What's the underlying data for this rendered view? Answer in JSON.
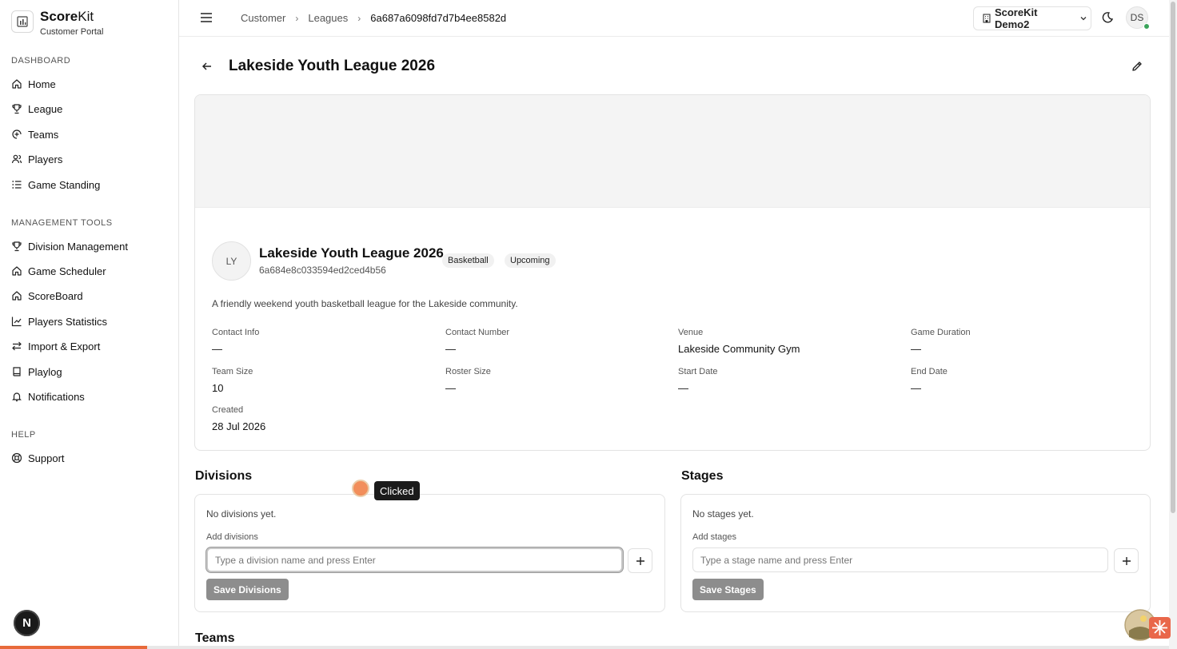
{
  "brand": {
    "name_bold": "Score",
    "name_light": "Kit",
    "subtitle": "Customer Portal"
  },
  "sidebar": {
    "sections": [
      {
        "label": "DASHBOARD"
      },
      {
        "label": "MANAGEMENT TOOLS"
      },
      {
        "label": "HELP"
      }
    ],
    "items": [
      {
        "label": "Home",
        "icon": "home-icon"
      },
      {
        "label": "League",
        "icon": "trophy-icon"
      },
      {
        "label": "Teams",
        "icon": "teams-icon"
      },
      {
        "label": "Players",
        "icon": "players-icon"
      },
      {
        "label": "Game Standing",
        "icon": "list-icon"
      },
      {
        "label": "Division Management",
        "icon": "trophy-icon"
      },
      {
        "label": "Game Scheduler",
        "icon": "home-icon"
      },
      {
        "label": "ScoreBoard",
        "icon": "home-icon"
      },
      {
        "label": "Players Statistics",
        "icon": "chart-icon"
      },
      {
        "label": "Import & Export",
        "icon": "swap-icon"
      },
      {
        "label": "Playlog",
        "icon": "book-icon"
      },
      {
        "label": "Notifications",
        "icon": "bell-icon"
      },
      {
        "label": "Support",
        "icon": "lifebuoy-icon"
      }
    ],
    "bottom_badge": "N"
  },
  "header": {
    "breadcrumbs": [
      "Customer",
      "Leagues",
      "6a687a6098fd7d7b4ee8582d"
    ],
    "org_name": "ScoreKit Demo2",
    "avatar_initials": "DS"
  },
  "page": {
    "title": "Lakeside Youth League 2026"
  },
  "league": {
    "avatar_initials": "LY",
    "name": "Lakeside Youth League 2026",
    "id": "6a684e8c033594ed2ced4b56",
    "badges": [
      "Basketball",
      "Upcoming"
    ],
    "description": "A friendly weekend youth basketball league for the Lakeside community.",
    "fields": [
      {
        "label": "Contact Info",
        "value": "—"
      },
      {
        "label": "Contact Number",
        "value": "—"
      },
      {
        "label": "Venue",
        "value": "Lakeside Community Gym"
      },
      {
        "label": "Game Duration",
        "value": "—"
      },
      {
        "label": "Team Size",
        "value": "10"
      },
      {
        "label": "Roster Size",
        "value": "—"
      },
      {
        "label": "Start Date",
        "value": "—"
      },
      {
        "label": "End Date",
        "value": "—"
      },
      {
        "label": "Created",
        "value": "28 Jul 2026"
      }
    ]
  },
  "divisions": {
    "title": "Divisions",
    "empty": "No divisions yet.",
    "add_label": "Add divisions",
    "placeholder": "Type a division name and press Enter",
    "save_label": "Save Divisions"
  },
  "stages": {
    "title": "Stages",
    "empty": "No stages yet.",
    "add_label": "Add stages",
    "placeholder": "Type a stage name and press Enter",
    "save_label": "Save Stages"
  },
  "teams": {
    "title": "Teams"
  },
  "overlay": {
    "click_tooltip": "Clicked"
  },
  "colors": {
    "accent": "#e86a3a",
    "button_disabled": "#8d8d8d",
    "online": "#3aa35a"
  }
}
